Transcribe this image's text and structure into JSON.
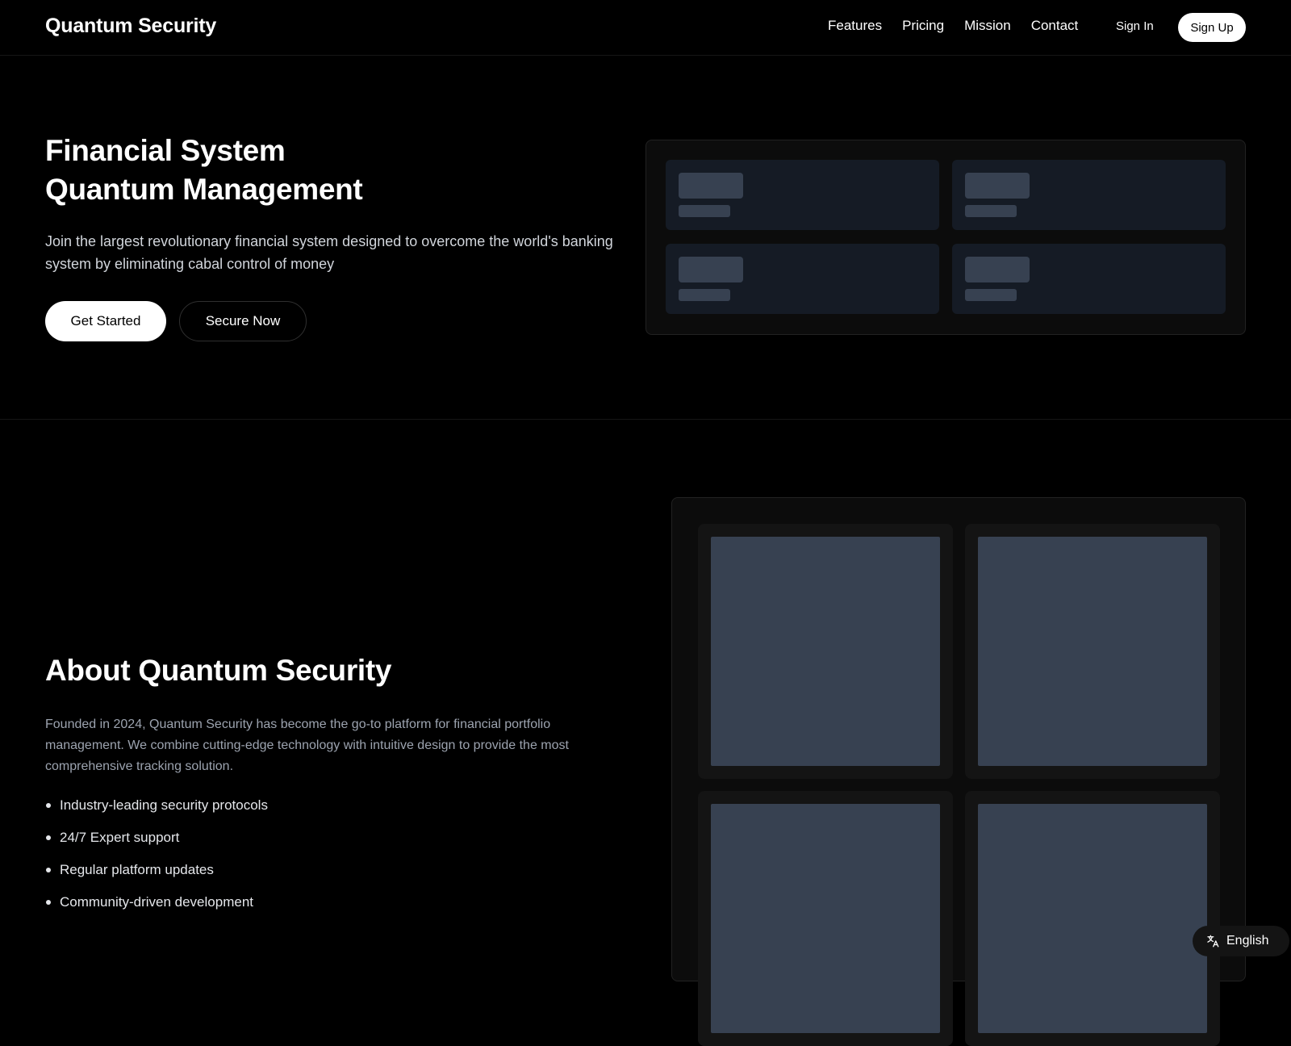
{
  "header": {
    "brand": "Quantum Security",
    "nav": [
      "Features",
      "Pricing",
      "Mission",
      "Contact"
    ],
    "sign_in": "Sign In",
    "sign_up": "Sign Up"
  },
  "hero": {
    "title_line1": "Financial System",
    "title_line2": "Quantum Management",
    "subtitle": "Join the largest revolutionary financial system designed to overcome the world's banking system by eliminating cabal control of money",
    "primary_button": "Get Started",
    "secondary_button": "Secure Now"
  },
  "about": {
    "title": "About Quantum Security",
    "text": "Founded in 2024, Quantum Security has become the go-to platform for financial portfolio management. We combine cutting-edge technology with intuitive design to provide the most comprehensive tracking solution.",
    "features": [
      "Industry-leading security protocols",
      "24/7 Expert support",
      "Regular platform updates",
      "Community-driven development"
    ]
  },
  "language": {
    "label": "English",
    "icon": "translate-icon"
  },
  "colors": {
    "background": "#000000",
    "placeholder": "#374151",
    "card": "#151b25"
  }
}
